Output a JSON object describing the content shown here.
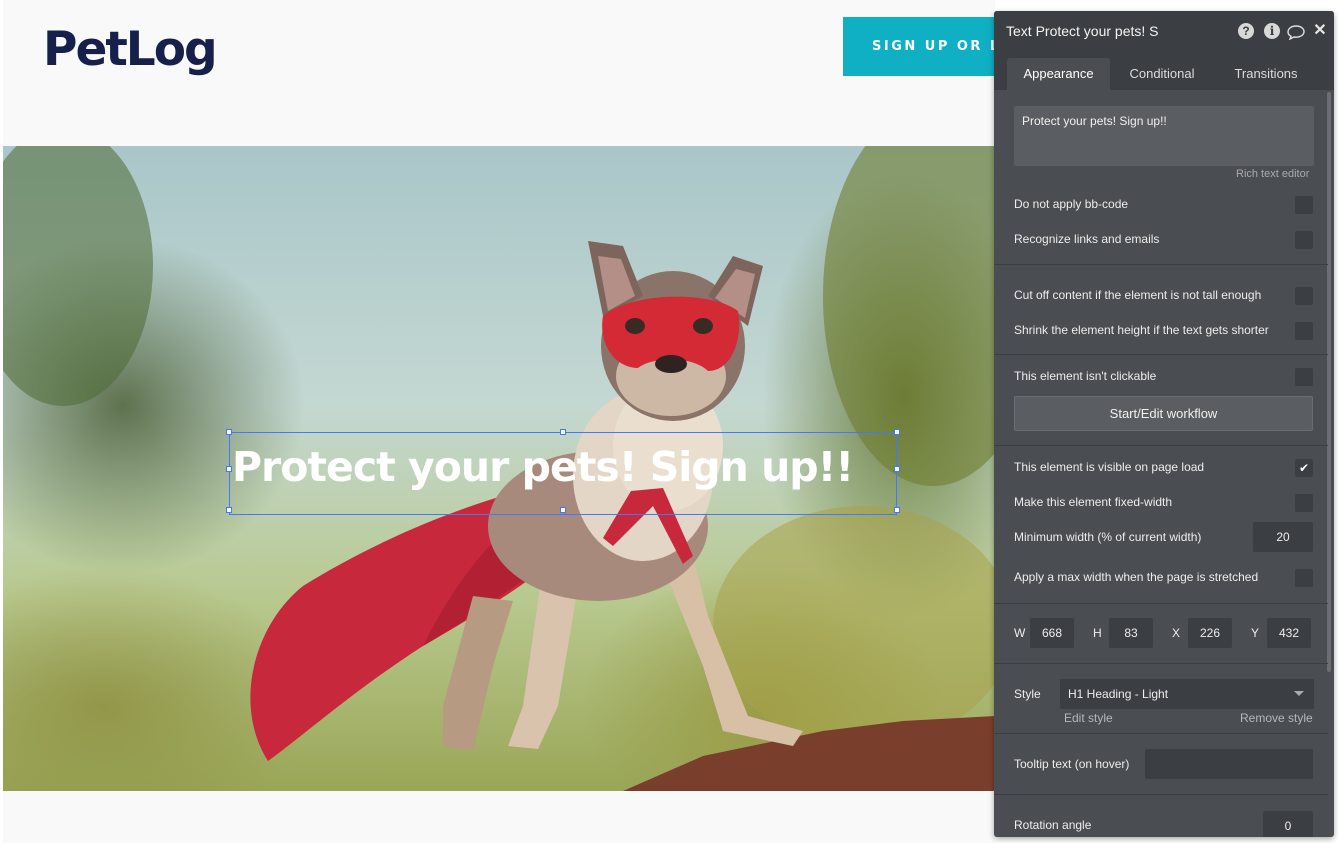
{
  "page": {
    "logo": "PetLog",
    "signup_button": "SIGN UP OR LOG IN",
    "hero_heading": "Protect your pets! Sign up!!"
  },
  "panel": {
    "title": "Text Protect your pets! S",
    "tabs": [
      "Appearance",
      "Conditional",
      "Transitions"
    ],
    "active_tab": "Appearance",
    "text_content": "Protect your pets! Sign up!!",
    "rich_text_link": "Rich text editor",
    "options": {
      "no_bbcode": "Do not apply bb-code",
      "recognize_links": "Recognize links and emails",
      "cut_off": "Cut off content if the element is not tall enough",
      "shrink_height": "Shrink the element height if the text gets shorter",
      "not_clickable": "This element isn't clickable",
      "visible_on_load": "This element is visible on page load",
      "fixed_width": "Make this element fixed-width",
      "min_width": "Minimum width (% of current width)",
      "max_width": "Apply a max width when the page is stretched"
    },
    "visible_on_load_checked": true,
    "min_width_value": "20",
    "workflow_button": "Start/Edit workflow",
    "dimensions": {
      "w_label": "W",
      "w": "668",
      "h_label": "H",
      "h": "83",
      "x_label": "X",
      "x": "226",
      "y_label": "Y",
      "y": "432"
    },
    "style_label": "Style",
    "style_value": "H1 Heading - Light",
    "edit_style": "Edit style",
    "remove_style": "Remove style",
    "tooltip_label": "Tooltip text (on hover)",
    "tooltip_value": "",
    "rotation_label": "Rotation angle",
    "rotation_value": "0"
  },
  "colors": {
    "accent": "#0fb0c3",
    "logo": "#16204a",
    "selection": "#4477ff",
    "panel_bg": "#4a4d51"
  }
}
